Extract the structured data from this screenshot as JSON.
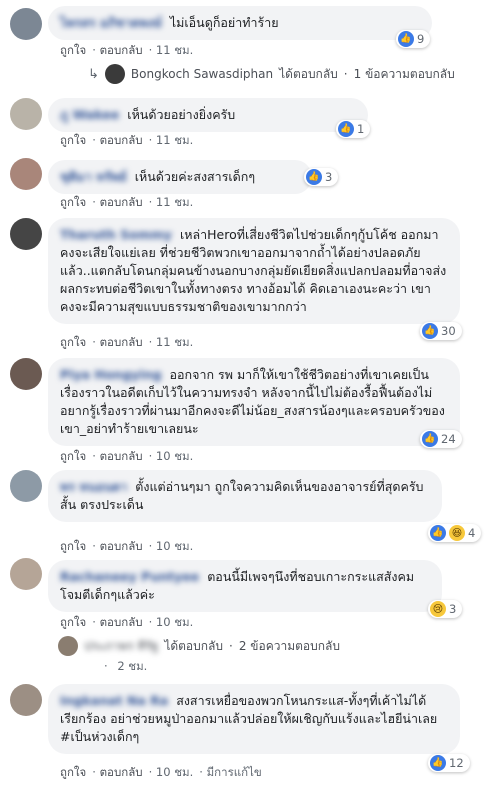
{
  "labels": {
    "like": "ถูกใจ",
    "reply": "ตอบกลับ",
    "edited": "มีการแก้ไข"
  },
  "comments": [
    {
      "name": "ไพรสร อภิชาตพงษ์",
      "text": "ไม่เอ็นดูก็อย่าทำร้าย",
      "time": "11 ชม.",
      "reactions": "9"
    },
    {
      "name": "ภู Wakee",
      "text": "เห็นด้วยอย่างยิ่งครับ",
      "time": "11 ชม.",
      "reactions": "1"
    },
    {
      "name": "ชุติมา ทรัพย์",
      "text": "เห็นด้วยค่ะสงสารเด็กๆ",
      "time": "11 ชม.",
      "reactions": "3"
    },
    {
      "name": "Tharuth Sommy",
      "text": "เหล่าHeroที่เสี่ยงชีวิตไปช่วยเด็กๆกู้บโค้ช ออกมาคงจะเสียใจแย่เลย ที่ช่วยชีวิตพวกเขาออกมาจากถ้ำได้อย่างปลอดภัยแล้ว..แตกลับโดนกลุ่มคนข้างนอกบางกลุ่มยัดเยียดสิ่งแปลกปลอมที่อาจส่งผลกระทบต่อชีวิตเขาในทั้งทางตรง ทางอ้อมได้ คิดเอาเองนะคะว่า เขาคงจะมีความสุขแบบธรรมชาติของเขามากกว่า",
      "time": "11 ชม.",
      "reactions": "30"
    },
    {
      "name": "Piya Hongying",
      "text": "ออกจาก รพ มาก็ให้เขาใช้ชีวิตอย่างที่เขาเคยเป็น เรื่องราวในอดีตเก็บไว้ในความทรงจำ หลังจากนี้ไปไม่ต้องรื้อฟื้นต้องไม่อยากรู้เรื่องราวที่ผ่านมาอีกคงจะดีไม่น้อย_สงสารน้องๆและครอบครัวของเขา_อย่าทำร้ายเขาเลยนะ",
      "time": "10 ชม.",
      "reactions": "24"
    },
    {
      "name": "พร หนอนตา",
      "text": "ตั้งแต่อ่านๆมา ถูกใจความคิดเห็นของอาจารย์ที่สุดครับ สั้น ตรงประเด็น",
      "time": "10 ชม.",
      "reactions": "4"
    },
    {
      "name": "Rachaneey Puntyee",
      "text": "ตอนนี้มีเพจๆนึงที่ชอบเกาะกระแสสังคม โจมตีเด็กๆแล้วค่ะ",
      "time": "10 ชม.",
      "reactions": "3"
    },
    {
      "name": "Ingkanat Na Ra",
      "text": "สงสารเหยื่อของพวกโหนกระแส-ทั้งๆที่เค้าไม่ได้เรียกร้อง อย่าช่วยหมูป่าออกมาแล้วปล่อยให้ผเชิญกับแร้งและไฮยีน่าเลย #เป็นห่วงเด็กๆ",
      "time": "10 ชม.",
      "reactions": "12"
    }
  ],
  "replies": [
    {
      "name": "Bongkoch Sawasdiphan",
      "action": "ได้ตอบกลับ",
      "count": "1 ข้อความตอบกลับ"
    },
    {
      "name": "ประภาพร ทีรัฐ",
      "action": "ได้ตอบกลับ",
      "count": "2 ข้อความตอบกลับ",
      "time": "2 ชม."
    }
  ]
}
